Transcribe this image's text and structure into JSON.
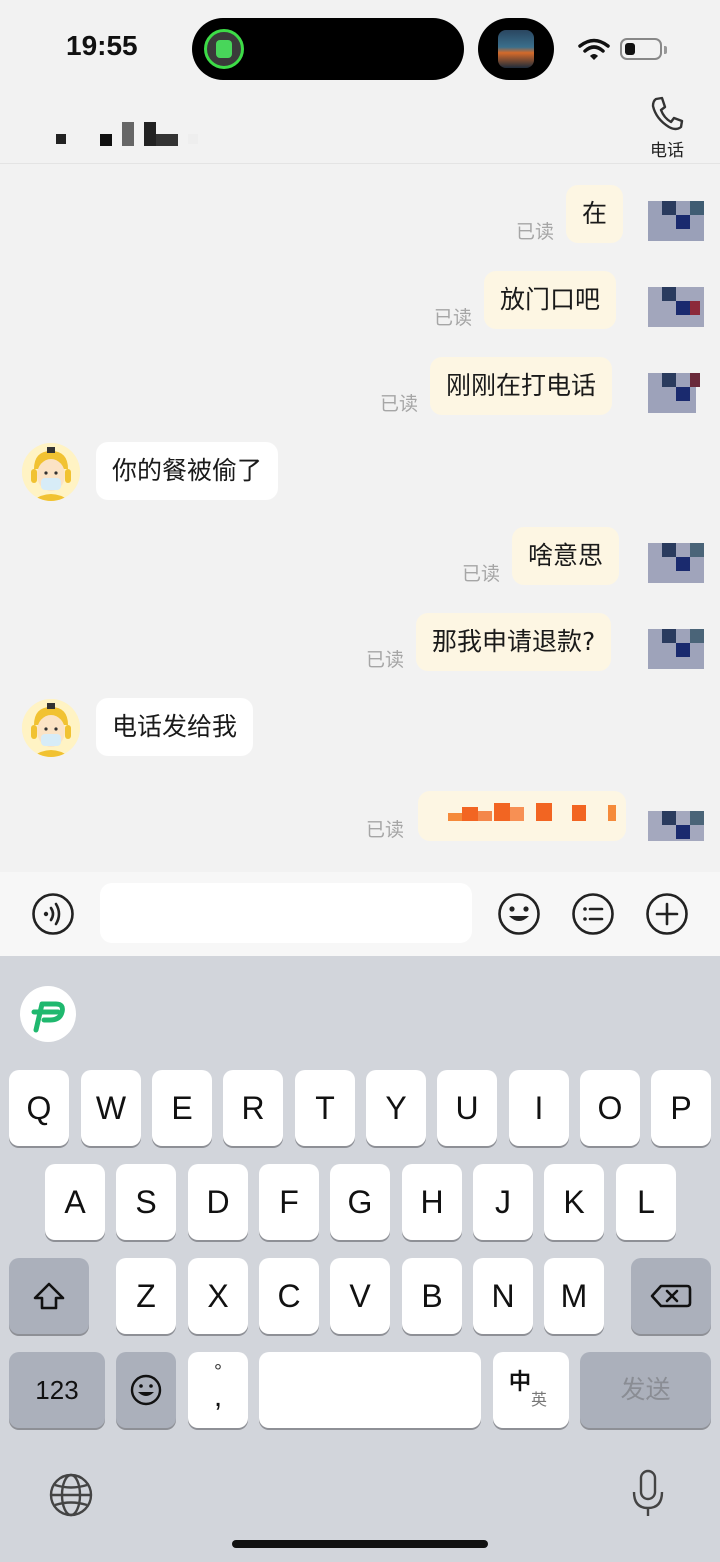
{
  "status_bar": {
    "time": "19:55",
    "wifi_icon": "wifi-icon",
    "battery_icon": "battery-icon"
  },
  "header": {
    "call_label": "电话",
    "call_icon": "phone-icon"
  },
  "messages": [
    {
      "side": "out",
      "text": "在",
      "read": "已读"
    },
    {
      "side": "out",
      "text": "放门口吧",
      "read": "已读"
    },
    {
      "side": "out",
      "text": "刚刚在打电话",
      "read": "已读"
    },
    {
      "side": "in",
      "text": "你的餐被偷了"
    },
    {
      "side": "out",
      "text": "啥意思",
      "read": "已读"
    },
    {
      "side": "out",
      "text": "那我申请退款?",
      "read": "已读"
    },
    {
      "side": "in",
      "text": "电话发给我"
    },
    {
      "side": "out",
      "text": "",
      "read": "已读",
      "redacted": true
    }
  ],
  "input_bar": {
    "voice_icon": "voice-icon",
    "emoji_icon": "emoji-icon",
    "list_icon": "list-icon",
    "plus_icon": "plus-icon",
    "placeholder": ""
  },
  "keyboard": {
    "row1": [
      "Q",
      "W",
      "E",
      "R",
      "T",
      "Y",
      "U",
      "I",
      "O",
      "P"
    ],
    "row2": [
      "A",
      "S",
      "D",
      "F",
      "G",
      "H",
      "J",
      "K",
      "L"
    ],
    "row3": [
      "Z",
      "X",
      "C",
      "V",
      "B",
      "N",
      "M"
    ],
    "numbers_key": "123",
    "punct_top": "°",
    "punct_bottom": ",",
    "lang_main": "中",
    "lang_sub": "英",
    "send_key": "发送",
    "colors": {
      "background": "#d2d5db",
      "key": "#ffffff",
      "dark_key": "#abb0bb",
      "send_text": "#8a8d94"
    }
  },
  "colors": {
    "bubble_out": "#fdf6e3",
    "bubble_in": "#ffffff",
    "read_text": "#a6a6a6",
    "chat_bg": "#f2f2f2"
  }
}
